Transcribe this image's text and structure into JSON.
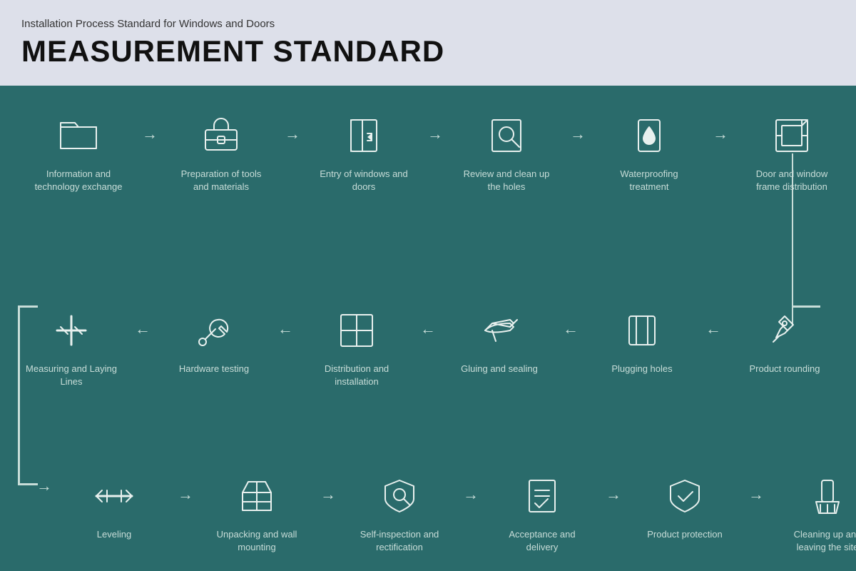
{
  "header": {
    "subtitle": "Installation Process Standard for Windows and Doors",
    "title": "MEASUREMENT STANDARD"
  },
  "row1": {
    "steps": [
      {
        "id": "info-exchange",
        "label": "Information and technology exchange",
        "icon": "folder"
      },
      {
        "id": "prep-tools",
        "label": "Preparation of tools and materials",
        "icon": "toolbox"
      },
      {
        "id": "entry-windows",
        "label": "Entry of windows and doors",
        "icon": "door-entry"
      },
      {
        "id": "review-holes",
        "label": "Review and clean up the holes",
        "icon": "magnify"
      },
      {
        "id": "waterproofing",
        "label": "Waterproofing treatment",
        "icon": "water"
      },
      {
        "id": "frame-dist",
        "label": "Door and window frame distribution",
        "icon": "frame"
      }
    ]
  },
  "row2": {
    "steps": [
      {
        "id": "measuring",
        "label": "Measuring and Laying Lines",
        "icon": "ruler-cross"
      },
      {
        "id": "hardware",
        "label": "Hardware testing",
        "icon": "wrench"
      },
      {
        "id": "dist-install",
        "label": "Distribution and installation",
        "icon": "grid-window"
      },
      {
        "id": "gluing",
        "label": "Gluing and sealing",
        "icon": "caulk-gun"
      },
      {
        "id": "plugging",
        "label": "Plugging holes",
        "icon": "plug-hole"
      },
      {
        "id": "rounding",
        "label": "Product rounding",
        "icon": "pushpin"
      }
    ]
  },
  "row3": {
    "steps": [
      {
        "id": "leveling",
        "label": "Leveling",
        "icon": "level"
      },
      {
        "id": "unpacking",
        "label": "Unpacking and wall mounting",
        "icon": "box-open"
      },
      {
        "id": "self-inspect",
        "label": "Self-inspection and rectification",
        "icon": "search-shield"
      },
      {
        "id": "acceptance",
        "label": "Acceptance and delivery",
        "icon": "doc-check"
      },
      {
        "id": "protection",
        "label": "Product protection",
        "icon": "shield-check"
      },
      {
        "id": "cleanup",
        "label": "Cleaning up and leaving the site",
        "icon": "broom"
      }
    ]
  },
  "arrows": {
    "right": "→",
    "left": "←"
  }
}
